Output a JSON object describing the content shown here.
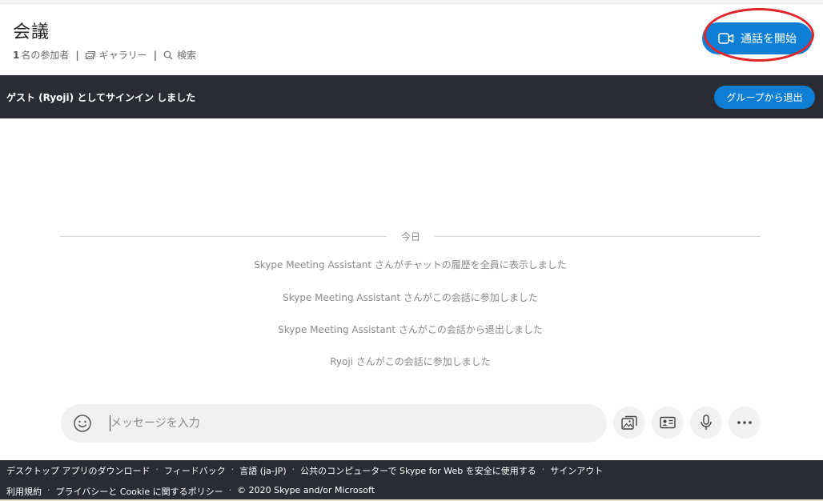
{
  "header": {
    "title": "会議",
    "participants_count": "1",
    "participants_label": "名の参加者",
    "gallery_label": "ギャラリー",
    "search_label": "検索",
    "start_call_label": "通話を開始"
  },
  "banner": {
    "text": "ゲスト (Ryoji) としてサインイン しました",
    "leave_label": "グループから退出"
  },
  "chat": {
    "day_label": "今日",
    "messages": [
      "Skype Meeting Assistant さんがチャットの履歴を全員に表示しました",
      "Skype Meeting Assistant さんがこの会話に参加しました",
      "Skype Meeting Assistant さんがこの会話から退出しました",
      "Ryoji さんがこの会話に参加しました"
    ]
  },
  "composer": {
    "placeholder": "メッセージを入力",
    "value": ""
  },
  "footer": {
    "row1": [
      "デスクトップ アプリのダウンロード",
      "フィードバック",
      "言語 (ja-JP)",
      "公共のコンピューターで Skype for Web を安全に使用する",
      "サインアウト"
    ],
    "row2": [
      "利用規約",
      "プライバシーと Cookie に関するポリシー",
      "© 2020 Skype and/or Microsoft"
    ]
  },
  "colors": {
    "accent": "#0f7fd6",
    "dark_bar": "#2b2c33",
    "annotation_ring": "#e0262a"
  },
  "icons": [
    "gallery-icon",
    "search-icon",
    "video-camera-icon",
    "emoji-icon",
    "image-icon",
    "contact-card-icon",
    "microphone-icon",
    "more-icon"
  ]
}
